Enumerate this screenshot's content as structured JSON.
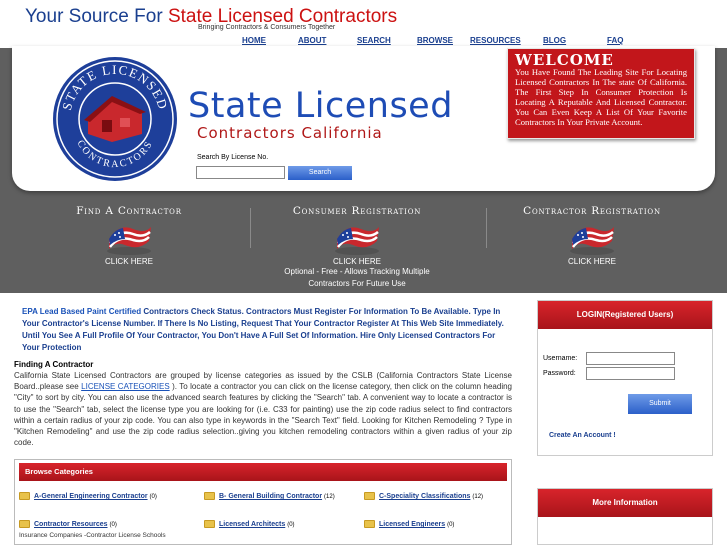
{
  "header": {
    "brand_prefix": "Your Source For ",
    "brand_highlight": "State Licensed Contractors",
    "tagline": "Bringing Contractors & Consumers Together"
  },
  "nav": [
    "HOME",
    "ABOUT",
    "SEARCH",
    "BROWSE",
    "RESOURCES",
    "BLOG",
    "FAQ"
  ],
  "hero": {
    "title": "State Licensed",
    "subtitle": "Contractors California",
    "seal_top": "STATE LICENSED",
    "seal_bottom": "CONTRACTORS",
    "license_label": "Search By License No.",
    "license_value": "",
    "search_button": "Search"
  },
  "welcome": {
    "heading": "WELCOME",
    "text": "You Have Found The Leading Site For Locating Licensed Contractors In The state Of California. The First Step In Consumer Protection Is Locating A Reputable And Licensed Contractor. You Can Even Keep A List Of Your Favorite Contractors In Your Private Account."
  },
  "columns": [
    {
      "heading": "Find A Contractor",
      "link": "CLICK HERE",
      "note": ""
    },
    {
      "heading": "Consumer Registration",
      "link": "CLICK HERE",
      "note": "Optional - Free - Allows Tracking Multiple Contractors For Future Use"
    },
    {
      "heading": "Contractor Registration",
      "link": "CLICK HERE",
      "note": ""
    }
  ],
  "intro": {
    "epa": "EPA Lead Based Paint Certified",
    "text": " Contractors Check Status. Contractors Must Register For Information To Be Available. Type In Your Contractor's License Number. If There Is No Listing, Request That Your Contractor Register At This Web Site Immediately. Until You See A Full Profile Of Your Contractor, You Don't Have A Full Set Of Information. Hire Only Licensed Contractors For Your Protection"
  },
  "finding": {
    "heading": "Finding A Contractor",
    "text_before": "California State Licensed Contractors are grouped by license categories as issued by the CSLB (California Contractors State License Board..please see ",
    "link": "LICENSE CATEGORIES",
    "text_after": " ). To locate a contractor you can click on the license category, then click on the column heading \"City\" to sort by city. You can also use the advanced search features by clicking the \"Search\" tab. A convenient way to locate a contractor is to use the \"Search\" tab, select the license type you are looking for (i.e. C33 for painting) use the zip code radius select to find contractors within a certain radius of your zip code. You can also type in keywords in the \"Search Text\" field. Looking for Kitchen Remodeling ? Type in \"Kitchen Remodeling\" and use the zip code radius selection..giving you kitchen remodeling contractors within a given radius of your zip code."
  },
  "categories": {
    "heading": "Browse Categories",
    "items": [
      {
        "label": "A-General Engineering Contractor",
        "count": "(0)"
      },
      {
        "label": "B- General Building Contractor",
        "count": "(12)"
      },
      {
        "label": "C-Speciality Classifications",
        "count": "(12)"
      },
      {
        "label": "Contractor Resources",
        "count": "(0)"
      },
      {
        "label": "Licensed Architects",
        "count": "(0)"
      },
      {
        "label": "Licensed Engineers",
        "count": "(0)"
      }
    ],
    "subtext": "Insurance Companies -Contractor License Schools"
  },
  "login": {
    "heading": "LOGIN(Registered Users)",
    "username_label": "Username:",
    "password_label": "Password:",
    "username_value": "",
    "password_value": "",
    "submit": "Submit",
    "create": "Create An Account !"
  },
  "more_info": {
    "heading": "More Information"
  },
  "colors": {
    "brand_blue": "#1a3f8f",
    "accent_red": "#c2161b",
    "band_gray": "#5f5f5f",
    "button_blue": "#2b5fc9"
  },
  "icons": [
    "house-seal-icon",
    "us-flag-icon",
    "folder-icon"
  ]
}
